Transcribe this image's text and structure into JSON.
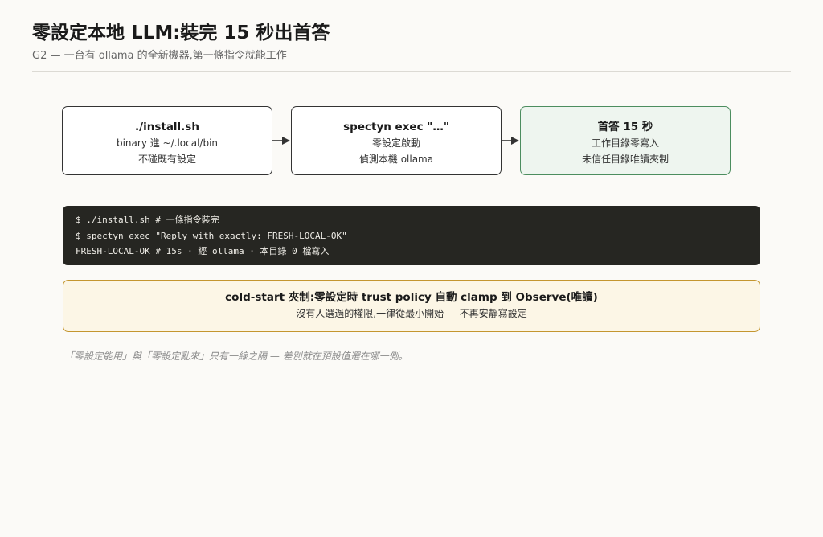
{
  "header": {
    "title": "零設定本地 LLM:裝完 15 秒出首答",
    "subtitle": "G2 — 一台有 ollama 的全新機器,第一條指令就能工作"
  },
  "steps": [
    {
      "title": "./install.sh",
      "line1": "binary 進 ~/.local/bin",
      "line2": "不碰既有設定"
    },
    {
      "title": "spectyn exec \"…\"",
      "line1": "零設定啟動",
      "line2": "偵測本機 ollama"
    },
    {
      "title": "首答 15 秒",
      "line1": "工作目錄零寫入",
      "line2": "未信任目錄唯讀夾制"
    }
  ],
  "terminal": {
    "lines": [
      "$ ./install.sh # 一條指令裝完",
      "$ spectyn exec \"Reply with exactly: FRESH-LOCAL-OK\"",
      "FRESH-LOCAL-OK # 15s · 經 ollama · 本目錄 0 檔寫入"
    ]
  },
  "callout": {
    "title": "cold-start 夾制:零設定時 trust policy 自動 clamp 到 Observe(唯讀)",
    "body": "沒有人選過的權限,一律從最小開始 — 不再安靜寫設定"
  },
  "note": "「零設定能用」與「零設定亂來」只有一線之隔 — 差別就在預設值選在哪一側。",
  "colors": {
    "success_border": "#4c8d5f",
    "success_fill": "#eef5ef",
    "warning_border": "#c4962f",
    "warning_fill": "#fcf6e6",
    "terminal_bg": "#262622"
  }
}
